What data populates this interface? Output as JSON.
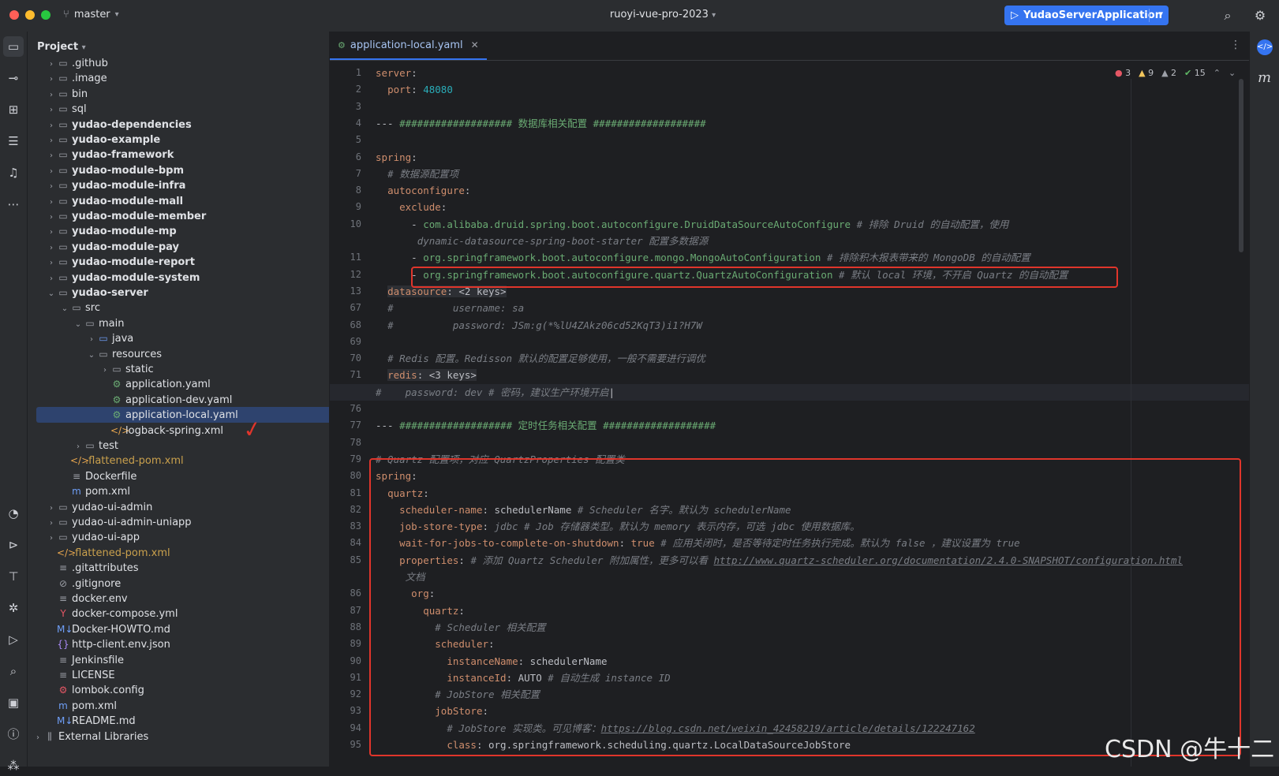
{
  "title_bar": {
    "branch": "master",
    "project_name": "ruoyi-vue-pro-2023",
    "run_config": "YudaoServerApplication"
  },
  "project_panel": {
    "title": "Project",
    "tree": [
      {
        "label": ".github",
        "type": "folder",
        "depth": 1,
        "bold": false
      },
      {
        "label": ".image",
        "type": "folder",
        "depth": 1,
        "bold": false
      },
      {
        "label": "bin",
        "type": "folder",
        "depth": 1,
        "bold": false
      },
      {
        "label": "sql",
        "type": "folder",
        "depth": 1,
        "bold": false
      },
      {
        "label": "yudao-dependencies",
        "type": "module",
        "depth": 1,
        "bold": true
      },
      {
        "label": "yudao-example",
        "type": "module",
        "depth": 1,
        "bold": true
      },
      {
        "label": "yudao-framework",
        "type": "module",
        "depth": 1,
        "bold": true
      },
      {
        "label": "yudao-module-bpm",
        "type": "module",
        "depth": 1,
        "bold": true
      },
      {
        "label": "yudao-module-infra",
        "type": "module",
        "depth": 1,
        "bold": true
      },
      {
        "label": "yudao-module-mall",
        "type": "module",
        "depth": 1,
        "bold": true
      },
      {
        "label": "yudao-module-member",
        "type": "module",
        "depth": 1,
        "bold": true
      },
      {
        "label": "yudao-module-mp",
        "type": "module",
        "depth": 1,
        "bold": true
      },
      {
        "label": "yudao-module-pay",
        "type": "module",
        "depth": 1,
        "bold": true
      },
      {
        "label": "yudao-module-report",
        "type": "module",
        "depth": 1,
        "bold": true
      },
      {
        "label": "yudao-module-system",
        "type": "module",
        "depth": 1,
        "bold": true
      },
      {
        "label": "yudao-server",
        "type": "module-open",
        "depth": 1,
        "bold": true
      },
      {
        "label": "src",
        "type": "folder-open",
        "depth": 2,
        "bold": false
      },
      {
        "label": "main",
        "type": "folder-open",
        "depth": 3,
        "bold": false
      },
      {
        "label": "java",
        "type": "folder-src",
        "depth": 4,
        "bold": false
      },
      {
        "label": "resources",
        "type": "folder-res-open",
        "depth": 4,
        "bold": false
      },
      {
        "label": "static",
        "type": "folder",
        "depth": 5,
        "bold": false
      },
      {
        "label": "application.yaml",
        "type": "yaml",
        "depth": 5,
        "bold": false
      },
      {
        "label": "application-dev.yaml",
        "type": "yaml",
        "depth": 5,
        "bold": false
      },
      {
        "label": "application-local.yaml",
        "type": "yaml",
        "depth": 5,
        "bold": false,
        "selected": true
      },
      {
        "label": "logback-spring.xml",
        "type": "xml",
        "depth": 5,
        "bold": false
      },
      {
        "label": "test",
        "type": "folder",
        "depth": 3,
        "bold": false
      },
      {
        "label": ".flattened-pom.xml",
        "type": "xml-ignored",
        "depth": 2,
        "bold": false
      },
      {
        "label": "Dockerfile",
        "type": "text",
        "depth": 2,
        "bold": false
      },
      {
        "label": "pom.xml",
        "type": "maven",
        "depth": 2,
        "bold": false
      },
      {
        "label": "yudao-ui-admin",
        "type": "folder",
        "depth": 1,
        "bold": false
      },
      {
        "label": "yudao-ui-admin-uniapp",
        "type": "folder",
        "depth": 1,
        "bold": false
      },
      {
        "label": "yudao-ui-app",
        "type": "folder",
        "depth": 1,
        "bold": false
      },
      {
        "label": ".flattened-pom.xml",
        "type": "xml-ignored",
        "depth": 1,
        "bold": false
      },
      {
        "label": ".gitattributes",
        "type": "text",
        "depth": 1,
        "bold": false
      },
      {
        "label": ".gitignore",
        "type": "ignore",
        "depth": 1,
        "bold": false
      },
      {
        "label": "docker.env",
        "type": "text",
        "depth": 1,
        "bold": false
      },
      {
        "label": "docker-compose.yml",
        "type": "yml",
        "depth": 1,
        "bold": false
      },
      {
        "label": "Docker-HOWTO.md",
        "type": "md",
        "depth": 1,
        "bold": false
      },
      {
        "label": "http-client.env.json",
        "type": "json",
        "depth": 1,
        "bold": false
      },
      {
        "label": "Jenkinsfile",
        "type": "text",
        "depth": 1,
        "bold": false
      },
      {
        "label": "LICENSE",
        "type": "text",
        "depth": 1,
        "bold": false
      },
      {
        "label": "lombok.config",
        "type": "config",
        "depth": 1,
        "bold": false
      },
      {
        "label": "pom.xml",
        "type": "maven",
        "depth": 1,
        "bold": false
      },
      {
        "label": "README.md",
        "type": "md",
        "depth": 1,
        "bold": false
      },
      {
        "label": "External Libraries",
        "type": "libs",
        "depth": 0,
        "bold": false
      }
    ]
  },
  "editor": {
    "tab_label": "application-local.yaml",
    "inspections": {
      "errors": "3",
      "warnings": "9",
      "weak_warnings": "2",
      "ok": "15"
    },
    "lines": [
      {
        "no": "1",
        "html": "<span class='k'>server</span><span class='p'>:</span>"
      },
      {
        "no": "2",
        "html": "  <span class='k'>port</span><span class='p'>: </span><span class='n'>48080</span>"
      },
      {
        "no": "3",
        "html": ""
      },
      {
        "no": "4",
        "html": "<span class='p'>--- </span><span class='s'>################### 数据库相关配置 ###################</span>"
      },
      {
        "no": "5",
        "html": ""
      },
      {
        "no": "6",
        "html": "<span class='k'>spring</span><span class='p'>:</span>"
      },
      {
        "no": "7",
        "html": "  <span class='c'># 数据源配置项</span>"
      },
      {
        "no": "8",
        "html": "  <span class='k'>autoconfigure</span><span class='p'>:</span>"
      },
      {
        "no": "9",
        "html": "    <span class='k'>exclude</span><span class='p'>:</span>"
      },
      {
        "no": "10",
        "html": "      <span class='p'>- </span><span class='s'>com.alibaba.druid.spring.boot.autoconfigure.DruidDataSourceAutoConfigure</span> <span class='c'># 排除 Druid 的自动配置，使用</span>"
      },
      {
        "no": "",
        "html": "       <span class='c'>dynamic-datasource-spring-boot-starter 配置多数据源</span>"
      },
      {
        "no": "11",
        "html": "      <span class='p'>- </span><span class='s'>org.springframework.boot.autoconfigure.mongo.MongoAutoConfiguration</span> <span class='c'># 排除积木报表带来的 MongoDB 的自动配置</span>"
      },
      {
        "no": "12",
        "html": "      <span class='p'>- </span><span class='s'>org.springframework.boot.autoconfigure.quartz.QuartzAutoConfiguration</span> <span class='c'># 默认 local 环境，不开启 Quartz 的自动配置</span>"
      },
      {
        "no": "13",
        "html": "  <span class='fold'><span class='k'>datasource</span><span class='p'>: &lt;2 keys&gt;</span></span>"
      },
      {
        "no": "67",
        "html": "  <span class='c'>#          username: sa</span>"
      },
      {
        "no": "68",
        "html": "  <span class='c'>#          password: JSm:g(*%lU4ZAkz06cd52KqT3)i1?H7W</span>"
      },
      {
        "no": "69",
        "html": ""
      },
      {
        "no": "70",
        "html": "  <span class='c'># Redis 配置。Redisson 默认的配置足够使用，一般不需要进行调优</span>"
      },
      {
        "no": "71",
        "html": "  <span class='fold'><span class='k'>redis</span><span class='p'>: &lt;3 keys&gt;</span></span>"
      },
      {
        "no": "75",
        "html": "<span class='c'>#    password: dev # 密码，建议生产环境开启</span><span class='p'>|</span>"
      },
      {
        "no": "76",
        "html": ""
      },
      {
        "no": "77",
        "html": "<span class='p'>--- </span><span class='s'>################### 定时任务相关配置 ###################</span>"
      },
      {
        "no": "78",
        "html": ""
      },
      {
        "no": "79",
        "html": "<span class='c'># Quartz 配置项，对应 QuartzProperties 配置类</span>"
      },
      {
        "no": "80",
        "html": "<span class='k'>spring</span><span class='p'>:</span>"
      },
      {
        "no": "81",
        "html": "  <span class='k'>quartz</span><span class='p'>:</span>"
      },
      {
        "no": "82",
        "html": "    <span class='k'>scheduler-name</span><span class='p'>: schedulerName </span><span class='c'># Scheduler 名字。默认为 schedulerName</span>"
      },
      {
        "no": "83",
        "html": "    <span class='k'>job-store-type</span><span class='p'>: </span><span class='c'>jdbc</span> <span class='c'># Job 存储器类型。默认为 memory 表示内存，可选 jdbc 使用数据库。</span>"
      },
      {
        "no": "84",
        "html": "    <span class='k'>wait-for-jobs-to-complete-on-shutdown</span><span class='p'>: </span><span class='k'>true</span> <span class='c'># 应用关闭时，是否等待定时任务执行完成。默认为 false ，建议设置为 true</span>"
      },
      {
        "no": "85",
        "html": "    <span class='k'>properties</span><span class='p'>: </span><span class='c'># 添加 Quartz Scheduler 附加属性，更多可以看 </span><span class='u'>http://www.quartz-scheduler.org/documentation/2.4.0-SNAPSHOT/configuration.html</span>"
      },
      {
        "no": "",
        "html": "     <span class='c'>文档</span>"
      },
      {
        "no": "86",
        "html": "      <span class='k'>org</span><span class='p'>:</span>"
      },
      {
        "no": "87",
        "html": "        <span class='k'>quartz</span><span class='p'>:</span>"
      },
      {
        "no": "88",
        "html": "          <span class='c'># Scheduler 相关配置</span>"
      },
      {
        "no": "89",
        "html": "          <span class='k'>scheduler</span><span class='p'>:</span>"
      },
      {
        "no": "90",
        "html": "            <span class='k'>instanceName</span><span class='p'>: schedulerName</span>"
      },
      {
        "no": "91",
        "html": "            <span class='k'>instanceId</span><span class='p'>: AUTO </span><span class='c'># 自动生成 instance ID</span>"
      },
      {
        "no": "92",
        "html": "          <span class='c'># JobStore 相关配置</span>"
      },
      {
        "no": "93",
        "html": "          <span class='k'>jobStore</span><span class='p'>:</span>"
      },
      {
        "no": "94",
        "html": "            <span class='c'># JobStore 实现类。可见博客：</span><span class='u'>https://blog.csdn.net/weixin_42458219/article/details/122247162</span>"
      },
      {
        "no": "95",
        "html": "            <span class='k'>class</span><span class='p'>: org.springframework.scheduling.quartz.LocalDataSourceJobStore</span>"
      }
    ]
  },
  "watermark": "CSDN @牛十二",
  "colors": {
    "accent": "#3574f0",
    "annotation_red": "#e0352b",
    "selection": "#2e436e"
  }
}
